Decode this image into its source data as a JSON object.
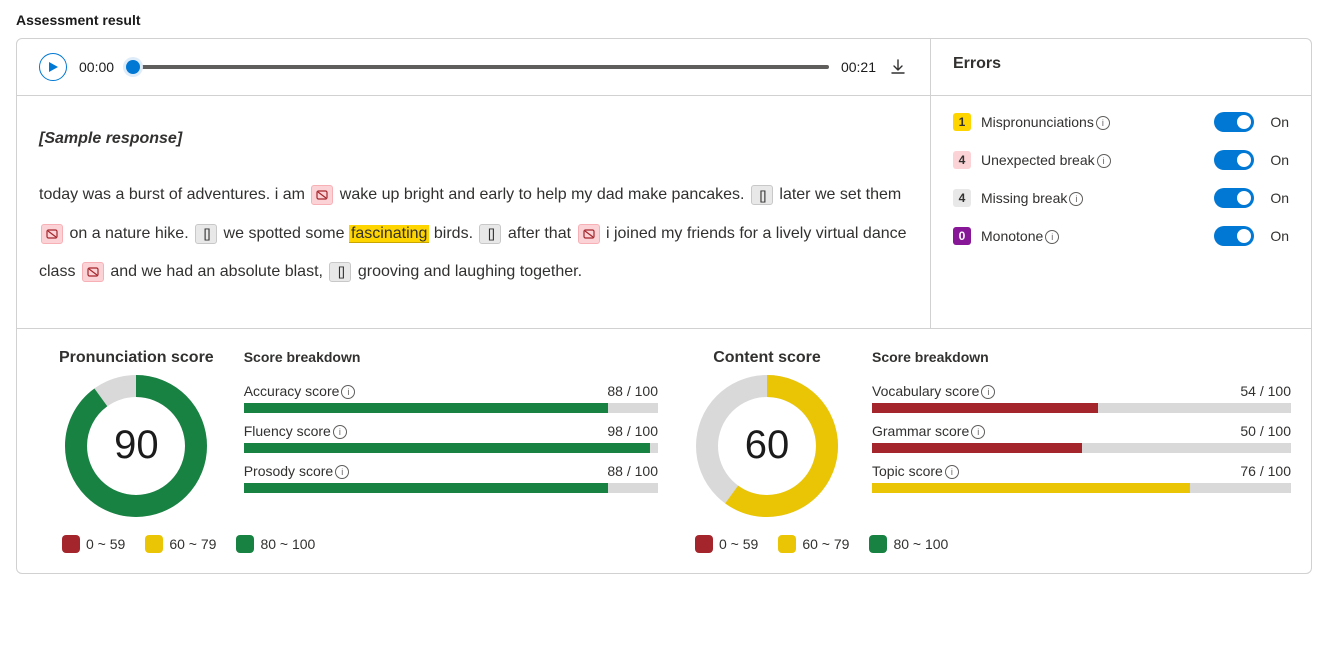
{
  "page_title": "Assessment result",
  "audio": {
    "current": "00:00",
    "total": "00:21"
  },
  "errors_panel_title": "Errors",
  "errors": [
    {
      "count": "1",
      "label": "Mispronunciations",
      "badge_class": "badge-yellow",
      "state": "On"
    },
    {
      "count": "4",
      "label": "Unexpected break",
      "badge_class": "badge-pink",
      "state": "On"
    },
    {
      "count": "4",
      "label": "Missing break",
      "badge_class": "badge-gray",
      "state": "On"
    },
    {
      "count": "0",
      "label": "Monotone",
      "badge_class": "badge-purple",
      "state": "On"
    }
  ],
  "transcript": {
    "header": "[Sample response]",
    "segments": [
      {
        "t": "text",
        "v": "today was a burst of adventures. i am "
      },
      {
        "t": "pause"
      },
      {
        "t": "text",
        "v": " wake up bright and early to help my dad make pancakes. "
      },
      {
        "t": "missing"
      },
      {
        "t": "text",
        "v": " later we set them "
      },
      {
        "t": "pause"
      },
      {
        "t": "text",
        "v": " on a nature hike. "
      },
      {
        "t": "missing"
      },
      {
        "t": "text",
        "v": " we spotted some "
      },
      {
        "t": "mispron",
        "v": "fascinating"
      },
      {
        "t": "text",
        "v": " birds. "
      },
      {
        "t": "missing"
      },
      {
        "t": "text",
        "v": " after that "
      },
      {
        "t": "pause"
      },
      {
        "t": "text",
        "v": " i joined my friends for a lively virtual dance class "
      },
      {
        "t": "pause"
      },
      {
        "t": "text",
        "v": " and we had an absolute blast, "
      },
      {
        "t": "missing"
      },
      {
        "t": "text",
        "v": " grooving and laughing together."
      }
    ]
  },
  "scores": {
    "pronunciation": {
      "title": "Pronunciation score",
      "value": "90",
      "pct": 90,
      "color": "#188243",
      "breakdown_title": "Score breakdown",
      "rows": [
        {
          "label": "Accuracy score",
          "score": "88 / 100",
          "pct": 88,
          "fill": "fill-green"
        },
        {
          "label": "Fluency score",
          "score": "98 / 100",
          "pct": 98,
          "fill": "fill-green"
        },
        {
          "label": "Prosody score",
          "score": "88 / 100",
          "pct": 88,
          "fill": "fill-green"
        }
      ]
    },
    "content": {
      "title": "Content score",
      "value": "60",
      "pct": 60,
      "color": "#eac505",
      "breakdown_title": "Score breakdown",
      "rows": [
        {
          "label": "Vocabulary score",
          "score": "54 / 100",
          "pct": 54,
          "fill": "fill-red"
        },
        {
          "label": "Grammar score",
          "score": "50 / 100",
          "pct": 50,
          "fill": "fill-red"
        },
        {
          "label": "Topic score",
          "score": "76 / 100",
          "pct": 76,
          "fill": "fill-yellow"
        }
      ]
    }
  },
  "legend": [
    {
      "sw": "sw-red",
      "label": "0 ~ 59"
    },
    {
      "sw": "sw-yellow",
      "label": "60 ~ 79"
    },
    {
      "sw": "sw-green",
      "label": "80 ~ 100"
    }
  ],
  "chart_data": [
    {
      "type": "pie",
      "title": "Pronunciation score",
      "values": [
        90,
        10
      ],
      "categories": [
        "score",
        "remaining"
      ],
      "colors": [
        "#188243",
        "#d9d9d9"
      ]
    },
    {
      "type": "pie",
      "title": "Content score",
      "values": [
        60,
        40
      ],
      "categories": [
        "score",
        "remaining"
      ],
      "colors": [
        "#eac505",
        "#d9d9d9"
      ]
    },
    {
      "type": "bar",
      "title": "Pronunciation score breakdown",
      "categories": [
        "Accuracy score",
        "Fluency score",
        "Prosody score"
      ],
      "values": [
        88,
        98,
        88
      ],
      "ylim": [
        0,
        100
      ]
    },
    {
      "type": "bar",
      "title": "Content score breakdown",
      "categories": [
        "Vocabulary score",
        "Grammar score",
        "Topic score"
      ],
      "values": [
        54,
        50,
        76
      ],
      "ylim": [
        0,
        100
      ]
    }
  ]
}
